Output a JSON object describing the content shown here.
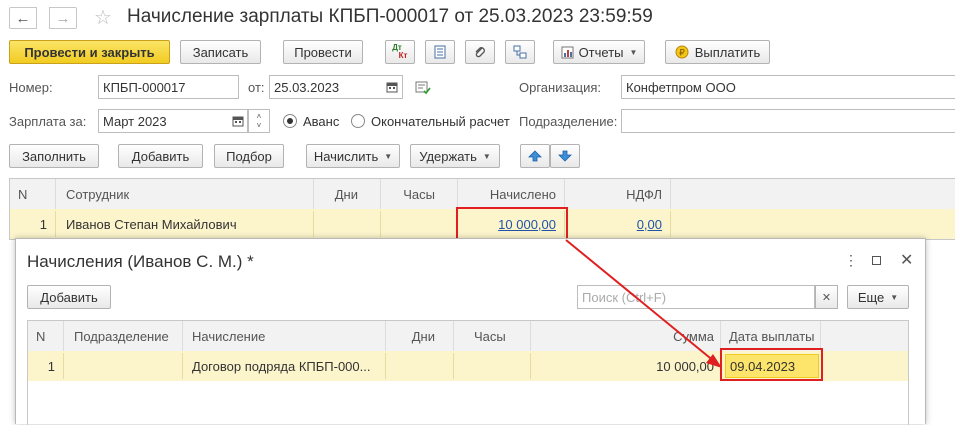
{
  "window": {
    "title": "Начисление зарплаты КПБП-000017 от 25.03.2023 23:59:59"
  },
  "toolbar": {
    "post_close": "Провести и закрыть",
    "save": "Записать",
    "post": "Провести",
    "reports": "Отчеты",
    "pay": "Выплатить",
    "dtkt_top": "Дт",
    "dtkt_bottom": "Кт"
  },
  "form": {
    "number_label": "Номер:",
    "number_value": "КПБП-000017",
    "from_label": "от:",
    "date_value": "25.03.2023",
    "org_label": "Организация:",
    "org_value": "Конфетпром ООО",
    "period_label": "Зарплата за:",
    "period_value": "Март 2023",
    "radio_advance": "Аванс",
    "radio_final": "Окончательный расчет",
    "division_label": "Подразделение:",
    "division_value": ""
  },
  "actions": {
    "fill": "Заполнить",
    "add": "Добавить",
    "select": "Подбор",
    "accrue": "Начислить",
    "withhold": "Удержать"
  },
  "grid": {
    "columns": [
      "N",
      "Сотрудник",
      "Дни",
      "Часы",
      "Начислено",
      "НДФЛ"
    ],
    "rows": [
      {
        "n": "1",
        "employee": "Иванов Степан Михайлович",
        "days": "",
        "hours": "",
        "accrued": "10 000,00",
        "ndfl": "0,00"
      }
    ]
  },
  "subwindow": {
    "title": "Начисления (Иванов С. М.) *",
    "add": "Добавить",
    "search_placeholder": "Поиск (Ctrl+F)",
    "more": "Еще",
    "columns": [
      "N",
      "Подразделение",
      "Начисление",
      "Дни",
      "Часы",
      "Сумма",
      "Дата выплаты"
    ],
    "rows": [
      {
        "n": "1",
        "division": "",
        "accrual": "Договор подряда КПБП-000...",
        "days": "",
        "hours": "",
        "sum": "10 000,00",
        "pay_date": "09.04.2023"
      }
    ]
  },
  "colors": {
    "highlight_row": "#fcf5cc",
    "annotation": "#e02020",
    "primary_button": "#f2cb21"
  }
}
